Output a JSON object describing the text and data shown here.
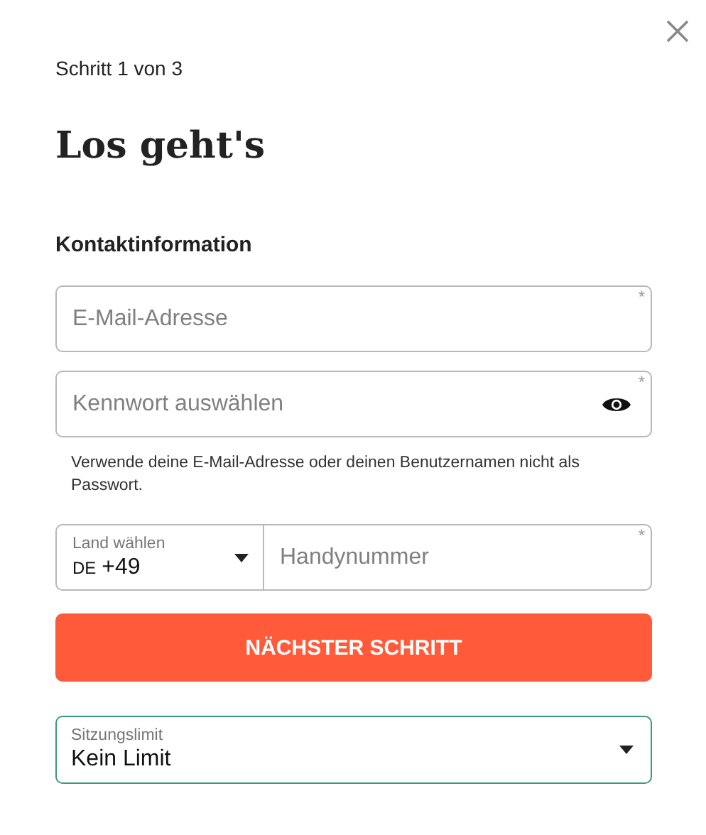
{
  "step": "Schritt 1 von 3",
  "title": "Los geht's",
  "section": "Kontaktinformation",
  "email": {
    "placeholder": "E-Mail-Adresse",
    "required_mark": "*"
  },
  "password": {
    "placeholder": "Kennwort auswählen",
    "required_mark": "*"
  },
  "password_hint": "Verwende deine E-Mail-Adresse oder deinen Benutzernamen nicht als Passwort.",
  "phone": {
    "country_label": "Land wählen",
    "country_code": "DE",
    "dial_code": "+49",
    "placeholder": "Handynummer",
    "required_mark": "*"
  },
  "next_button": "NÄCHSTER SCHRITT",
  "session_limit": {
    "label": "Sitzungslimit",
    "value": "Kein Limit",
    "focused": true
  }
}
